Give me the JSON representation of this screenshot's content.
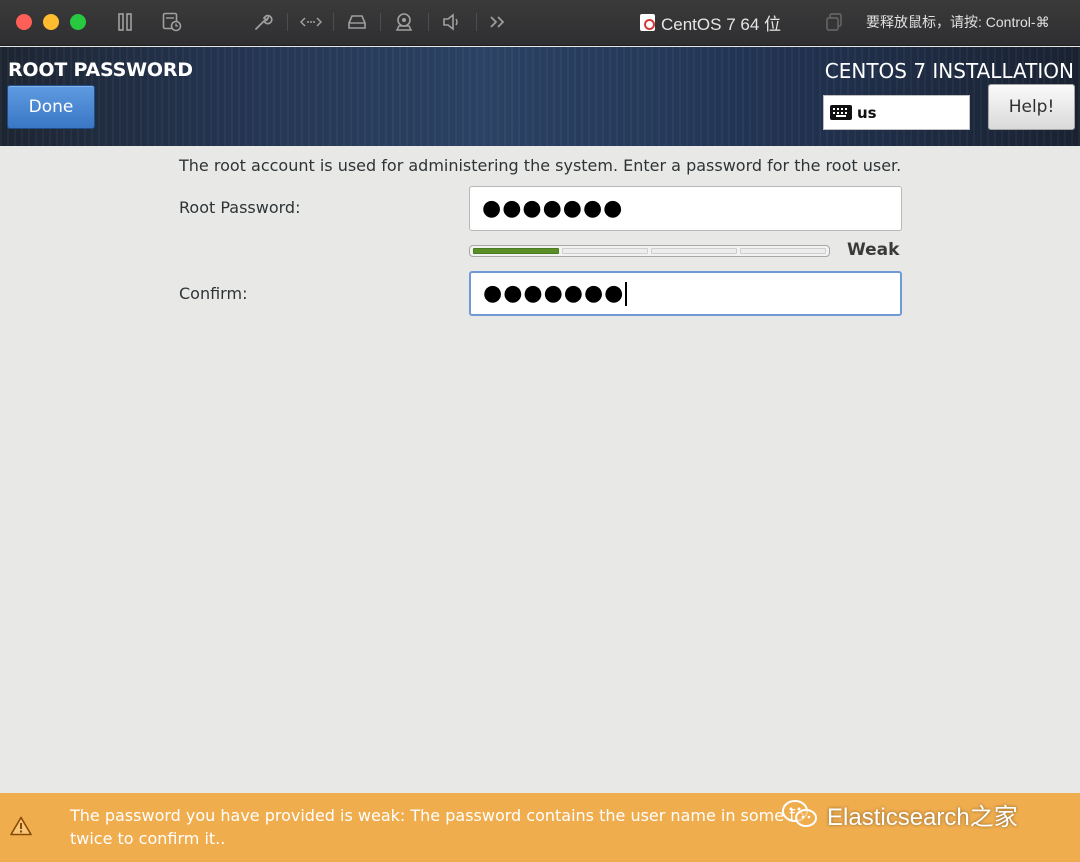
{
  "vm_window": {
    "title": "CentOS 7 64 位",
    "release_hint": "要释放鼠标，请按: Control-⌘",
    "toolbar_icons": [
      "pause-icon",
      "snapshot-icon",
      "settings-wrench-icon",
      "network-icon",
      "hard-disk-icon",
      "camera-icon",
      "sound-icon",
      "more-icon"
    ]
  },
  "header": {
    "spoke_title": "ROOT PASSWORD",
    "done_label": "Done",
    "product_title": "CENTOS 7 INSTALLATION",
    "keyboard_layout": "us",
    "help_label": "Help!"
  },
  "form": {
    "intro": "The root account is used for administering the system.  Enter a password for the root user.",
    "root_password_label": "Root Password:",
    "root_password_value": "●●●●●●●",
    "strength_label": "Weak",
    "strength_level": 0.25,
    "confirm_label": "Confirm:",
    "confirm_value": "●●●●●●●"
  },
  "warning": {
    "line1": "The password you have provided is weak: The password contains the user name in some fo",
    "line2": "twice to confirm it..",
    "color": "#f0ad4e"
  },
  "watermark": "Elasticsearch之家"
}
